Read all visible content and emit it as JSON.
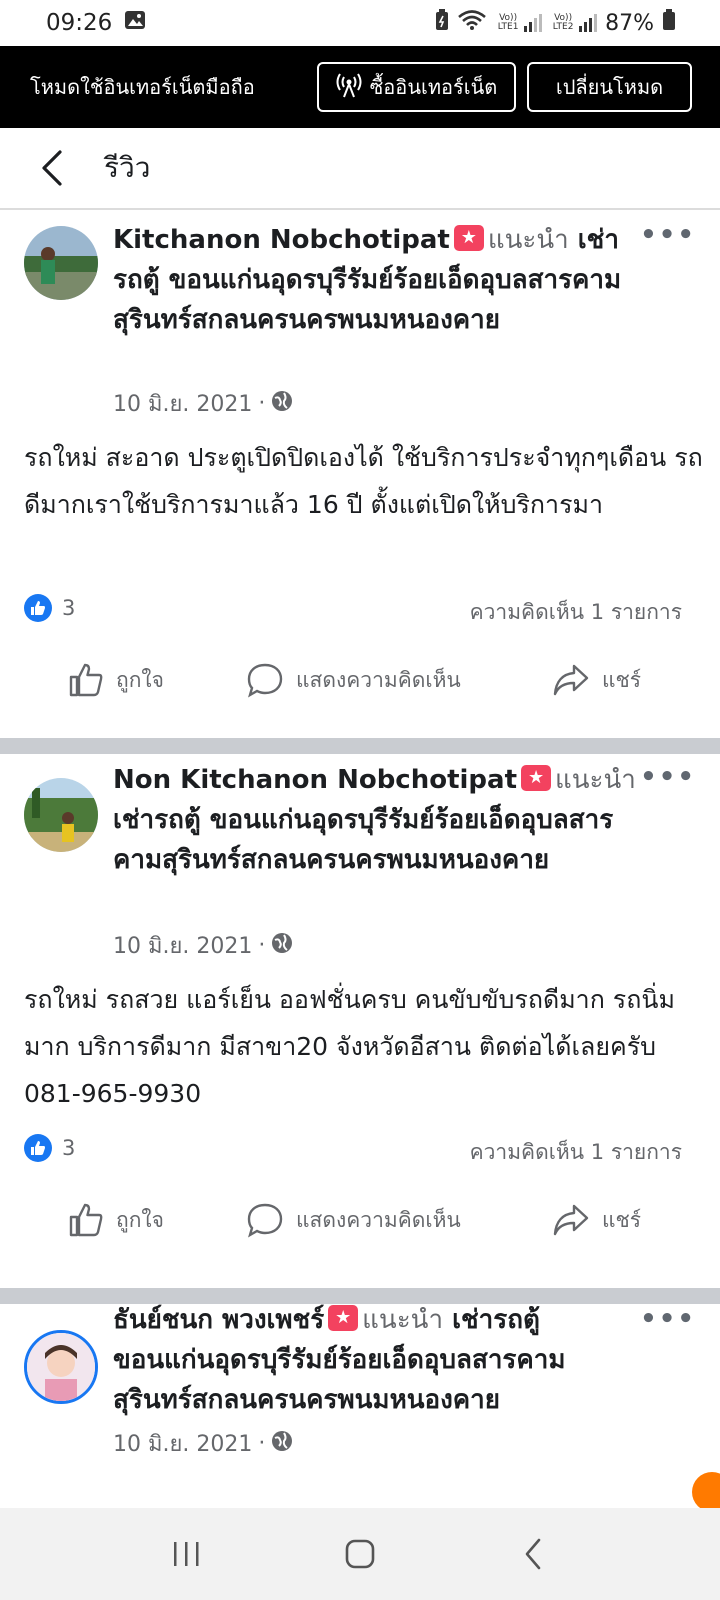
{
  "status_bar": {
    "time": "09:26",
    "lte1_label": "Vo)) LTE1",
    "lte2_label": "Vo)) LTE2",
    "battery": "87%"
  },
  "mode_banner": {
    "text": "โหมดใช้อินเทอร์เน็ตมือถือ",
    "buy_label": "ซื้ออินเทอร์เน็ต",
    "switch_label": "เปลี่ยนโหมด"
  },
  "header": {
    "title": "รีวิว"
  },
  "reviews": [
    {
      "name": "Kitchanon Nobchotipat",
      "recommend": "แนะนำ",
      "page": "เช่ารถตู้ ขอนแก่นอุดรบุรีรัมย์ร้อยเอ็ดอุบลสารคามสุรินทร์สกลนครนครพนมหนองคาย",
      "date": "10 มิ.ย. 2021",
      "text": "รถใหม่ สะอาด ประตูเปิดปิดเองได้ ใช้บริการประจำทุกๆเดือน รถดีมากเราใช้บริการมาแล้ว 16 ปี ตั้งแต่เปิดให้บริการมา",
      "likes": "3",
      "comments": "ความคิดเห็น 1 รายการ"
    },
    {
      "name": "Non Kitchanon Nobchotipat",
      "recommend": "แนะนำ",
      "page": "เช่ารถตู้ ขอนแก่นอุดรบุรีรัมย์ร้อยเอ็ดอุบลสารคามสุรินทร์สกลนครนครพนมหนองคาย",
      "date": "10 มิ.ย. 2021",
      "text": "รถใหม่ รถสวย แอร์เย็น ออฟชั่นครบ คนขับขับรถดีมาก รถนิ่มมาก บริการดีมาก มีสาขา20 จังหวัดอีสาน ติดต่อได้เลยครับ 081-965-9930",
      "likes": "3",
      "comments": "ความคิดเห็น 1 รายการ"
    },
    {
      "name": "ธันย์ชนก พวงเพชร์",
      "recommend": "แนะนำ",
      "page": "เช่ารถตู้ ขอนแก่นอุดรบุรีรัมย์ร้อยเอ็ดอุบลสารคามสุรินทร์สกลนครนครพนมหนองคาย",
      "date": "10 มิ.ย. 2021"
    }
  ],
  "actions": {
    "like": "ถูกใจ",
    "comment": "แสดงความคิดเห็น",
    "share": "แชร์"
  },
  "badge_glyph": "★",
  "colors": {
    "banner_bg": "#000000",
    "recommend_badge": "#f3425f",
    "like_blue": "#1877f2",
    "separator": "#c9ccd1"
  }
}
